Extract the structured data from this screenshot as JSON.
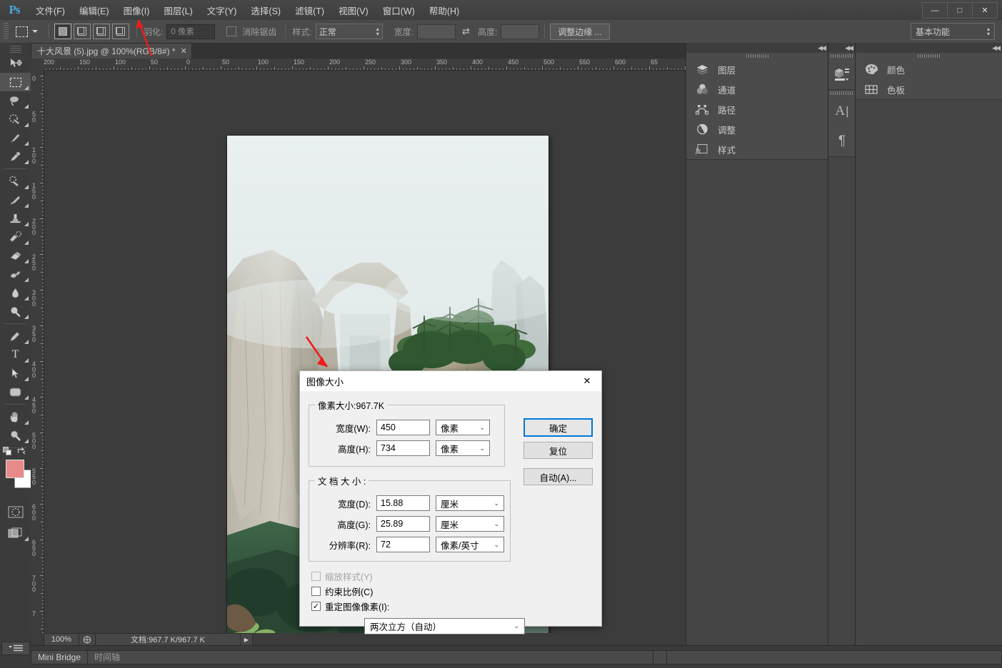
{
  "app": {
    "logo": "Ps",
    "menus": [
      {
        "label": "文件(F)"
      },
      {
        "label": "编辑(E)"
      },
      {
        "label": "图像(I)"
      },
      {
        "label": "图层(L)"
      },
      {
        "label": "文字(Y)"
      },
      {
        "label": "选择(S)"
      },
      {
        "label": "滤镜(T)"
      },
      {
        "label": "视图(V)"
      },
      {
        "label": "窗口(W)"
      },
      {
        "label": "帮助(H)"
      }
    ],
    "window_controls": {
      "minimize": "—",
      "maximize": "□",
      "close": "✕"
    }
  },
  "options_bar": {
    "tool_icon": "rectangular-marquee-icon",
    "feather_label": "羽化:",
    "feather_value": "0 像素",
    "antialias_label": "消除锯齿",
    "style_label": "样式:",
    "style_value": "正常",
    "width_label": "宽度:",
    "width_value": "",
    "swap_icon": "⇄",
    "height_label": "高度:",
    "height_value": "",
    "refine_edge": "调整边缘 ...",
    "workspace": "基本功能"
  },
  "toolbar": {
    "tools": [
      {
        "name": "move-tool",
        "glyph": "⊹"
      },
      {
        "name": "rectangular-marquee-tool",
        "glyph": "▭",
        "selected": true
      },
      {
        "name": "lasso-tool",
        "glyph": "🖅"
      },
      {
        "name": "quick-selection-tool",
        "glyph": "✧"
      },
      {
        "name": "crop-tool",
        "glyph": "⌁"
      },
      {
        "name": "eyedropper-tool",
        "glyph": "⚲"
      },
      {
        "name": "spot-healing-brush-tool",
        "glyph": "✎"
      },
      {
        "name": "brush-tool",
        "glyph": "🖌"
      },
      {
        "name": "clone-stamp-tool",
        "glyph": "⎙"
      },
      {
        "name": "history-brush-tool",
        "glyph": "✍"
      },
      {
        "name": "eraser-tool",
        "glyph": "▱"
      },
      {
        "name": "gradient-tool",
        "glyph": "◧"
      },
      {
        "name": "blur-tool",
        "glyph": "💧"
      },
      {
        "name": "dodge-tool",
        "glyph": "🔍"
      },
      {
        "name": "pen-tool",
        "glyph": "✒"
      },
      {
        "name": "horizontal-type-tool",
        "glyph": "T"
      },
      {
        "name": "path-selection-tool",
        "glyph": "➤"
      },
      {
        "name": "rounded-rectangle-tool",
        "glyph": "▢"
      },
      {
        "name": "hand-tool",
        "glyph": "✋"
      },
      {
        "name": "zoom-tool",
        "glyph": "🔎"
      }
    ],
    "foreground_color": "#e98a8a",
    "background_color": "#ffffff",
    "quick-mask-icon": "quick-mask-mode-icon",
    "screen-mode-icon": "screen-mode-icon"
  },
  "document": {
    "tab_title": "十大风景 (5).jpg @ 100%(RGB/8#) *",
    "tab_close": "✕",
    "ruler_h_labels": [
      "200",
      "150",
      "100",
      "50",
      "0",
      "50",
      "100",
      "150",
      "200",
      "250",
      "300",
      "350",
      "400",
      "450",
      "500",
      "550",
      "600",
      "65"
    ],
    "ruler_v_labels": [
      "0",
      "50",
      "100",
      "150",
      "200",
      "250",
      "300",
      "350",
      "400",
      "450",
      "500",
      "550",
      "600",
      "650",
      "700",
      "7"
    ],
    "zoom_level": "100%",
    "doc_info": "文档:967.7 K/967.7 K",
    "doc_info_arrow": "▶"
  },
  "bottom_bar": {
    "tabs": [
      {
        "label": "Mini Bridge",
        "dim": false
      },
      {
        "label": "时间轴",
        "dim": true
      }
    ],
    "menu_icon": "panel-menu-icon"
  },
  "panels": {
    "collapse_icon": "◀◀",
    "left_group": [
      {
        "label": "图层",
        "icon": "layers-icon"
      },
      {
        "label": "通道",
        "icon": "channels-icon"
      },
      {
        "label": "路径",
        "icon": "paths-icon"
      },
      {
        "label": "调整",
        "icon": "adjustments-icon"
      },
      {
        "label": "样式",
        "icon": "styles-icon"
      }
    ],
    "mid_icons": [
      {
        "name": "3d-panel-icon",
        "glyph": "▣"
      },
      {
        "name": "character-panel-icon",
        "glyph": "A"
      },
      {
        "name": "paragraph-panel-icon",
        "glyph": "¶"
      }
    ],
    "right_group": [
      {
        "label": "颜色",
        "icon": "color-panel-icon"
      },
      {
        "label": "色板",
        "icon": "swatches-panel-icon"
      }
    ]
  },
  "dialog": {
    "title": "图像大小",
    "close": "✕",
    "pixel_group_legend": "像素大小:967.7K",
    "doc_group_legend": "文 档 大 小 :",
    "fields": [
      {
        "label": "宽度(W):",
        "value": "450",
        "unit": "像素"
      },
      {
        "label": "高度(H):",
        "value": "734",
        "unit": "像素"
      },
      {
        "label": "宽度(D):",
        "value": "15.88",
        "unit": "厘米"
      },
      {
        "label": "高度(G):",
        "value": "25.89",
        "unit": "厘米"
      },
      {
        "label": "分辨率(R):",
        "value": "72",
        "unit": "像素/英寸"
      }
    ],
    "checkboxes": [
      {
        "label": "缩放样式(Y)",
        "checked": false,
        "disabled": true
      },
      {
        "label": "约束比例(C)",
        "checked": false,
        "disabled": false
      },
      {
        "label": "重定图像像素(I):",
        "checked": true,
        "disabled": false
      }
    ],
    "resample_value": "两次立方（自动）",
    "buttons": [
      {
        "label": "确定",
        "primary": true
      },
      {
        "label": "复位",
        "primary": false
      },
      {
        "label": "自动(A)...",
        "primary": false
      }
    ]
  },
  "annotations": {
    "arrow_color": "#ee1c1c",
    "arrow_menu_target": "图像(I)",
    "arrow_canvas_target": "canvas-rock-column"
  }
}
